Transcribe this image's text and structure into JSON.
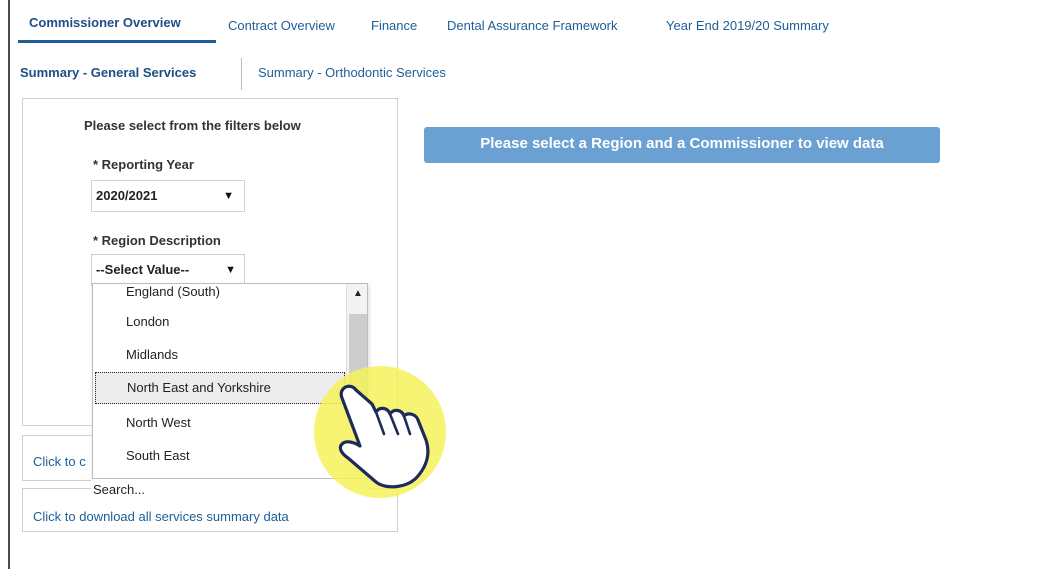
{
  "tabs": [
    {
      "label": "Commissioner Overview",
      "active": true
    },
    {
      "label": "Contract Overview"
    },
    {
      "label": "Finance"
    },
    {
      "label": "Dental Assurance Framework"
    },
    {
      "label": "Year End 2019/20 Summary"
    }
  ],
  "subtabs": [
    {
      "label": "Summary - General Services",
      "active": true
    },
    {
      "label": "Summary - Orthodontic Services"
    }
  ],
  "filters": {
    "title": "Please select from the filters below",
    "reporting_year_label": "* Reporting Year",
    "reporting_year_value": "2020/2021",
    "region_label": "* Region Description",
    "region_value": "--Select Value--",
    "caret": "▼"
  },
  "dropdown": {
    "items": [
      {
        "label": "England (South)"
      },
      {
        "label": "London"
      },
      {
        "label": "Midlands"
      },
      {
        "label": "North East and Yorkshire",
        "highlighted": true
      },
      {
        "label": "North West"
      },
      {
        "label": "South East"
      }
    ],
    "scroll_up": "▲",
    "search_text": "Search..."
  },
  "links": {
    "click_partial": "Click to c",
    "download_all": "Click to download all services summary data"
  },
  "info_message": "Please select a Region and a Commissioner to view data",
  "colors": {
    "link": "#1d5e99",
    "info_button": "#6aa1d2",
    "cursor_highlight": "#f6f25a"
  },
  "cursor": {
    "icon": "hand-pointer-icon"
  }
}
